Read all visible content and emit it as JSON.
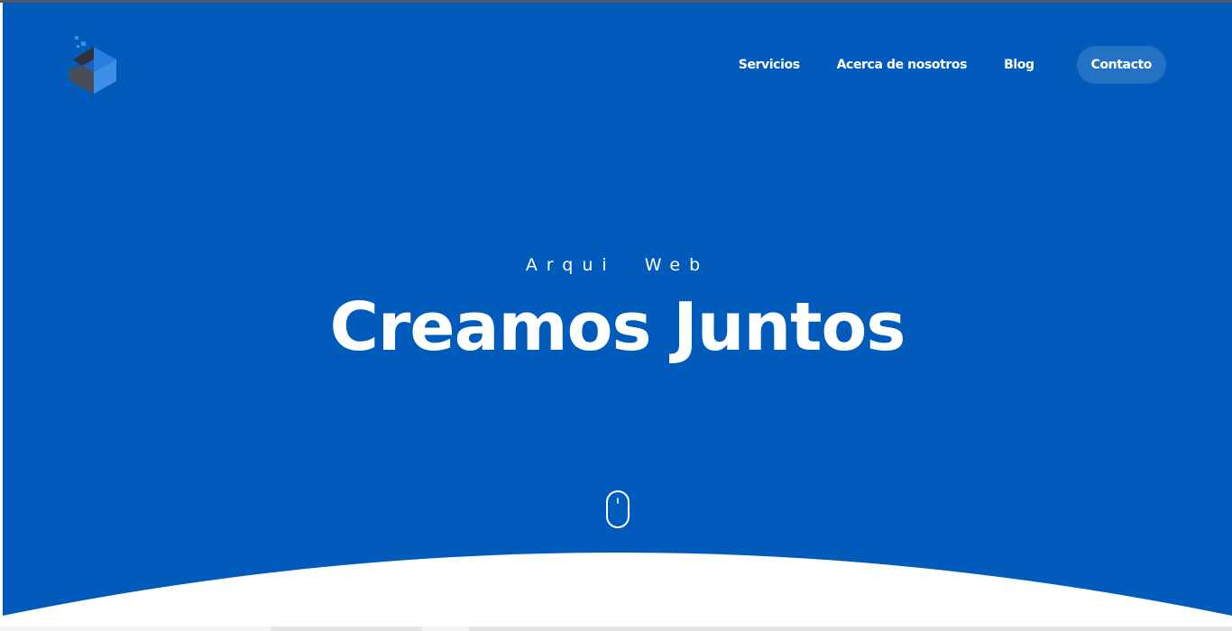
{
  "brand": {
    "logo_icon": "isometric-cube-logo-icon",
    "colors": {
      "hero_background": "#005bbb",
      "logo_light_blue": "#3d8fe8",
      "logo_dark": "#3a3f47",
      "white": "#ffffff"
    }
  },
  "nav": {
    "items": [
      {
        "label": "Servicios"
      },
      {
        "label": "Acerca de nosotros"
      },
      {
        "label": "Blog"
      }
    ],
    "contact_label": "Contacto"
  },
  "hero": {
    "eyebrow": "Arqui  Web",
    "headline": "Creamos Juntos",
    "scroll_icon": "mouse-scroll-icon"
  }
}
